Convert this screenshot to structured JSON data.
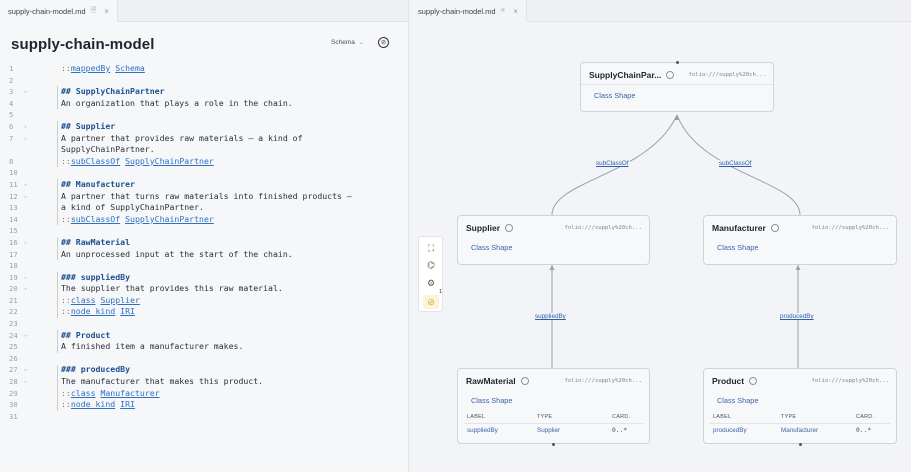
{
  "left": {
    "tab": {
      "label": "supply-chain-model.md",
      "file_icon": "file-icon",
      "close_icon": "close-icon"
    },
    "title": "supply-chain-model",
    "schema_select": {
      "value": "Schema"
    },
    "compass_icon": "compass-icon",
    "lines": [
      {
        "n": "1",
        "fold": "",
        "parts": [
          [
            "dir",
            "::"
          ],
          [
            "lnk",
            "mappedBy"
          ],
          [
            "",
            " "
          ],
          [
            "lnk",
            "Schema"
          ]
        ]
      },
      {
        "n": "2",
        "fold": "",
        "parts": []
      },
      {
        "n": "3",
        "fold": "v",
        "parts": [
          [
            "kw",
            "## SupplyChainPartner"
          ]
        ]
      },
      {
        "n": "4",
        "fold": "",
        "parts": [
          [
            "",
            "An organization that plays a role in the chain."
          ]
        ]
      },
      {
        "n": "5",
        "fold": "",
        "parts": []
      },
      {
        "n": "6",
        "fold": "v",
        "parts": [
          [
            "kw",
            "## Supplier"
          ]
        ]
      },
      {
        "n": "7",
        "fold": "v",
        "parts": [
          [
            "",
            "A partner that provides raw materials — a kind of"
          ]
        ]
      },
      {
        "n": "",
        "fold": "",
        "parts": [
          [
            "",
            "SupplyChainPartner."
          ]
        ]
      },
      {
        "n": "8",
        "fold": "",
        "parts": [
          [
            "dir",
            "::"
          ],
          [
            "lnk",
            "subClassOf"
          ],
          [
            "",
            " "
          ],
          [
            "lnk",
            "SupplyChainPartner"
          ]
        ]
      },
      {
        "n": "10",
        "fold": "",
        "parts": []
      },
      {
        "n": "11",
        "fold": "v",
        "parts": [
          [
            "kw",
            "## Manufacturer"
          ]
        ]
      },
      {
        "n": "12",
        "fold": "v",
        "parts": [
          [
            "",
            "A partner that turns raw materials into finished products —"
          ]
        ]
      },
      {
        "n": "13",
        "fold": "",
        "parts": [
          [
            "",
            "a kind of SupplyChainPartner."
          ]
        ]
      },
      {
        "n": "14",
        "fold": "",
        "parts": [
          [
            "dir",
            "::"
          ],
          [
            "lnk",
            "subClassOf"
          ],
          [
            "",
            " "
          ],
          [
            "lnk",
            "SupplyChainPartner"
          ]
        ]
      },
      {
        "n": "15",
        "fold": "",
        "parts": []
      },
      {
        "n": "16",
        "fold": "v",
        "parts": [
          [
            "kw",
            "## RawMaterial"
          ]
        ]
      },
      {
        "n": "17",
        "fold": "",
        "parts": [
          [
            "",
            "An unprocessed input at the start of the chain."
          ]
        ]
      },
      {
        "n": "18",
        "fold": "",
        "parts": []
      },
      {
        "n": "19",
        "fold": "v",
        "parts": [
          [
            "kw",
            "### suppliedBy"
          ]
        ]
      },
      {
        "n": "20",
        "fold": "v",
        "parts": [
          [
            "",
            "The supplier that provides this raw material."
          ]
        ]
      },
      {
        "n": "21",
        "fold": "",
        "parts": [
          [
            "dir",
            "::"
          ],
          [
            "lnk",
            "class"
          ],
          [
            "",
            " "
          ],
          [
            "lnk",
            "Supplier"
          ]
        ]
      },
      {
        "n": "22",
        "fold": "",
        "parts": [
          [
            "dir",
            "::"
          ],
          [
            "lnk",
            "node kind"
          ],
          [
            "",
            " "
          ],
          [
            "lnk",
            "IRI"
          ]
        ]
      },
      {
        "n": "23",
        "fold": "",
        "parts": []
      },
      {
        "n": "24",
        "fold": "v",
        "parts": [
          [
            "kw",
            "## Product"
          ]
        ]
      },
      {
        "n": "25",
        "fold": "",
        "parts": [
          [
            "",
            "A finished item a manufacturer makes."
          ]
        ]
      },
      {
        "n": "26",
        "fold": "",
        "parts": []
      },
      {
        "n": "27",
        "fold": "v",
        "parts": [
          [
            "kw",
            "### producedBy"
          ]
        ]
      },
      {
        "n": "28",
        "fold": "v",
        "parts": [
          [
            "",
            "The manufacturer that makes this product."
          ]
        ]
      },
      {
        "n": "29",
        "fold": "",
        "parts": [
          [
            "dir",
            "::"
          ],
          [
            "lnk",
            "class"
          ],
          [
            "",
            " "
          ],
          [
            "lnk",
            "Manufacturer"
          ]
        ]
      },
      {
        "n": "30",
        "fold": "",
        "parts": [
          [
            "dir",
            "::"
          ],
          [
            "lnk",
            "node kind"
          ],
          [
            "",
            " "
          ],
          [
            "lnk",
            "IRI"
          ]
        ]
      },
      {
        "n": "31",
        "fold": "",
        "parts": []
      }
    ]
  },
  "right": {
    "tab": {
      "label": "supply-chain-model.md",
      "graph_icon": "graph-icon",
      "close_icon": "close-icon"
    },
    "toolbar": {
      "icons": [
        "focus-icon",
        "hierarchy-icon",
        "settings-icon",
        "hide-icon"
      ],
      "badge": "1"
    },
    "nodes": {
      "partner": {
        "name": "SupplyChainPar...",
        "url": "folio:///supply%20ch...",
        "shape": "Class Shape"
      },
      "supplier": {
        "name": "Supplier",
        "url": "folio:///supply%20ch...",
        "shape": "Class Shape"
      },
      "manufacturer": {
        "name": "Manufacturer",
        "url": "folio:///supply%20ch...",
        "shape": "Class Shape"
      },
      "rawmaterial": {
        "name": "RawMaterial",
        "url": "folio:///supply%20ch...",
        "shape": "Class Shape",
        "cols": [
          "LABEL",
          "TYPE",
          "CARD."
        ],
        "row": [
          "suppliedBy",
          "Supplier",
          "0..*"
        ]
      },
      "product": {
        "name": "Product",
        "url": "folio:///supply%20ch...",
        "shape": "Class Shape",
        "cols": [
          "LABEL",
          "TYPE",
          "CARD."
        ],
        "row": [
          "producedBy",
          "Manufacturer",
          "0..*"
        ]
      }
    },
    "edges": {
      "sub1": "subClassOf",
      "sub2": "subClassOf",
      "supplied": "suppliedBy",
      "produced": "producedBy"
    }
  }
}
